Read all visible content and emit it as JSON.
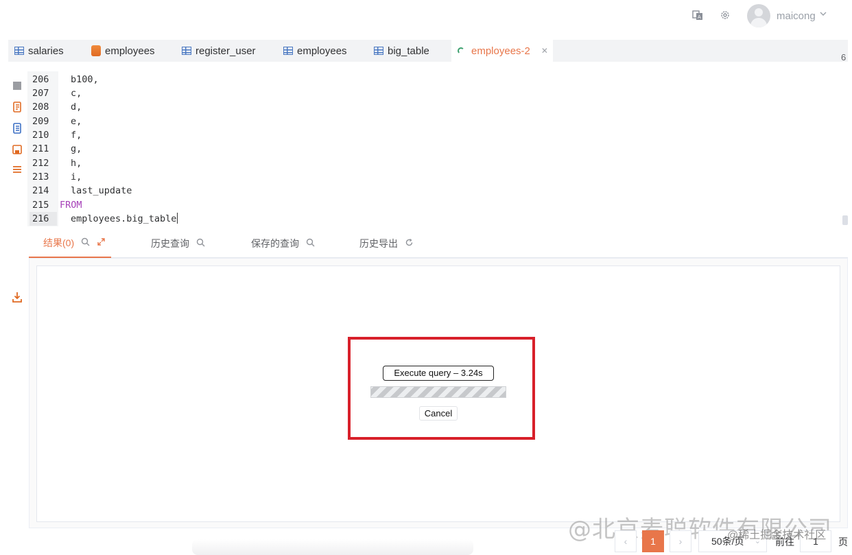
{
  "header": {
    "username": "maicong",
    "icons": [
      "translate-icon",
      "gear-icon",
      "avatar",
      "chevron-down-icon"
    ]
  },
  "tabs": [
    {
      "label": "salaries",
      "icon": "table-icon"
    },
    {
      "label": "employees",
      "icon": "database-icon"
    },
    {
      "label": "register_user",
      "icon": "table-icon"
    },
    {
      "label": "employees",
      "icon": "table-icon"
    },
    {
      "label": "big_table",
      "icon": "table-icon"
    },
    {
      "label": "employees-2",
      "icon": "loading-icon",
      "active": true
    }
  ],
  "tab_count": "6",
  "editor": {
    "lines": [
      {
        "num": "206",
        "code": "b100,"
      },
      {
        "num": "207",
        "code": "c,"
      },
      {
        "num": "208",
        "code": "d,"
      },
      {
        "num": "209",
        "code": "e,"
      },
      {
        "num": "210",
        "code": "f,"
      },
      {
        "num": "211",
        "code": "g,"
      },
      {
        "num": "212",
        "code": "h,"
      },
      {
        "num": "213",
        "code": "i,"
      },
      {
        "num": "214",
        "code": "last_update"
      },
      {
        "num": "215",
        "code": "FROM"
      },
      {
        "num": "216",
        "code": "employees.big_table"
      }
    ]
  },
  "result_tabs": [
    {
      "label": "结果(0)",
      "active": true
    },
    {
      "label": "历史查询"
    },
    {
      "label": "保存的查询"
    },
    {
      "label": "历史导出"
    }
  ],
  "dialog": {
    "status": "Execute query – 3.24s",
    "cancel_label": "Cancel"
  },
  "pagination": {
    "prev": "‹",
    "current_page": "1",
    "next": "›",
    "page_size": "50条/页",
    "goto_label": "前往",
    "goto_value": "1",
    "page_suffix": "页"
  },
  "watermark": {
    "main": "@北京麦聪软件有限公司",
    "sub": "@稀土掘金技术社区"
  },
  "colors": {
    "accent": "#e8764a",
    "highlight": "#d8202a",
    "keyword": "#a640b8"
  }
}
